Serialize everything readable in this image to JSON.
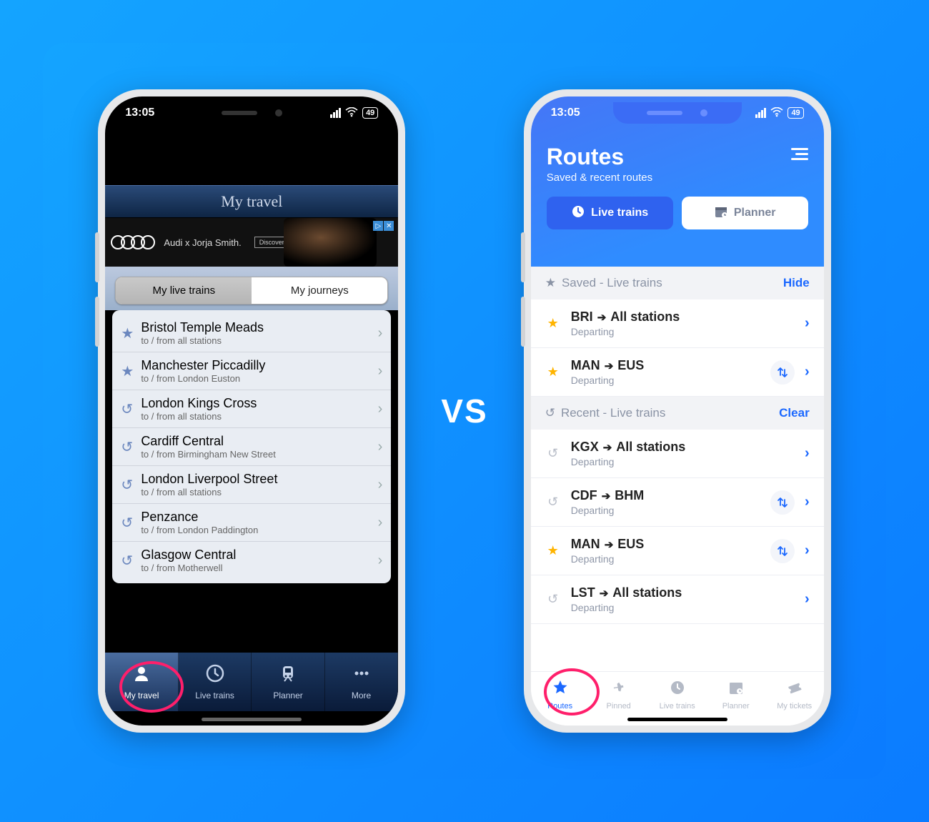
{
  "vs": "VS",
  "status": {
    "time": "13:05",
    "battery": "49"
  },
  "left": {
    "title": "My travel",
    "ad": {
      "brand_text": "Audi x Jorja Smith.",
      "cta": "Discover more"
    },
    "segments": {
      "active": "My live trains",
      "inactive": "My journeys"
    },
    "rows": [
      {
        "icon": "star",
        "title": "Bristol Temple Meads",
        "sub": "to / from all stations"
      },
      {
        "icon": "star",
        "title": "Manchester Piccadilly",
        "sub": "to / from London Euston"
      },
      {
        "icon": "history",
        "title": "London Kings Cross",
        "sub": "to / from all stations"
      },
      {
        "icon": "history",
        "title": "Cardiff Central",
        "sub": "to / from Birmingham New Street"
      },
      {
        "icon": "history",
        "title": "London Liverpool Street",
        "sub": "to / from all stations"
      },
      {
        "icon": "history",
        "title": "Penzance",
        "sub": "to / from London Paddington"
      },
      {
        "icon": "history",
        "title": "Glasgow Central",
        "sub": "to / from Motherwell"
      }
    ],
    "tabs": [
      {
        "label": "My travel",
        "icon": "person"
      },
      {
        "label": "Live trains",
        "icon": "clock"
      },
      {
        "label": "Planner",
        "icon": "train"
      },
      {
        "label": "More",
        "icon": "dots"
      }
    ]
  },
  "right": {
    "title": "Routes",
    "subtitle": "Saved & recent routes",
    "segments": {
      "primary": "Live trains",
      "secondary": "Planner"
    },
    "section_saved": {
      "label": "Saved - Live trains",
      "action": "Hide"
    },
    "saved": [
      {
        "icon": "star",
        "from": "BRI",
        "to": "All stations",
        "sub": "Departing",
        "swap": false
      },
      {
        "icon": "star",
        "from": "MAN",
        "to": "EUS",
        "sub": "Departing",
        "swap": true
      }
    ],
    "section_recent": {
      "label": "Recent - Live trains",
      "action": "Clear"
    },
    "recent": [
      {
        "icon": "history",
        "from": "KGX",
        "to": "All stations",
        "sub": "Departing",
        "swap": false
      },
      {
        "icon": "history",
        "from": "CDF",
        "to": "BHM",
        "sub": "Departing",
        "swap": true
      },
      {
        "icon": "star",
        "from": "MAN",
        "to": "EUS",
        "sub": "Departing",
        "swap": true
      },
      {
        "icon": "history",
        "from": "LST",
        "to": "All stations",
        "sub": "Departing",
        "swap": false
      }
    ],
    "tabs": [
      {
        "label": "Routes",
        "icon": "star"
      },
      {
        "label": "Pinned",
        "icon": "pin"
      },
      {
        "label": "Live trains",
        "icon": "clock"
      },
      {
        "label": "Planner",
        "icon": "calendar"
      },
      {
        "label": "My tickets",
        "icon": "ticket"
      }
    ]
  }
}
